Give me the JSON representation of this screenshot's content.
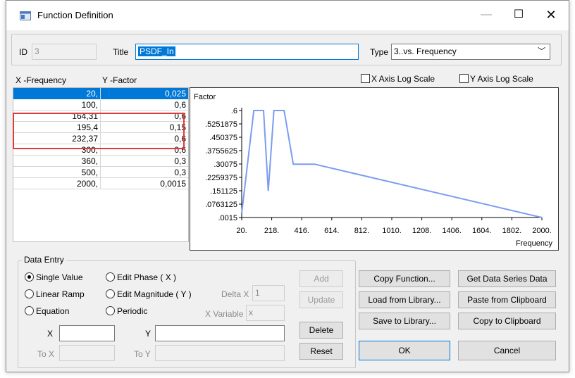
{
  "window": {
    "title": "Function Definition",
    "controls": {
      "minimize": "—",
      "maximize": "☐",
      "close": "✕"
    }
  },
  "header": {
    "id_label": "ID",
    "id_value": "3",
    "title_label": "Title",
    "title_value": "PSDF_In",
    "type_label": "Type",
    "type_value": "3..vs. Frequency"
  },
  "table": {
    "col_x": "X -Frequency",
    "col_y": "Y -Factor",
    "rows": [
      {
        "x": "20,",
        "y": "0,025"
      },
      {
        "x": "100,",
        "y": "0,6"
      },
      {
        "x": "164,31",
        "y": "0,6"
      },
      {
        "x": "195,4",
        "y": "0,15"
      },
      {
        "x": "232,37",
        "y": "0,6"
      },
      {
        "x": "300,",
        "y": "0,6"
      },
      {
        "x": "360,",
        "y": "0,3"
      },
      {
        "x": "500,",
        "y": "0,3"
      },
      {
        "x": "2000,",
        "y": "0,0015"
      }
    ]
  },
  "options": {
    "x_log": "X Axis Log Scale",
    "y_log": "Y Axis Log Scale"
  },
  "chart_data": {
    "type": "line",
    "ylabel": "Factor",
    "xlabel": "Frequency",
    "xlim": [
      20,
      2000
    ],
    "ylim": [
      0.0015,
      0.6
    ],
    "x_ticks": [
      "20.",
      "218.",
      "416.",
      "614.",
      "812.",
      "1010.",
      "1208.",
      "1406.",
      "1604.",
      "1802.",
      "2000."
    ],
    "y_ticks": [
      ".6",
      ".5251875",
      ".450375",
      ".3755625",
      ".30075",
      ".2259375",
      ".151125",
      ".0763125",
      ".0015"
    ],
    "x_tick_values": [
      20,
      218,
      416,
      614,
      812,
      1010,
      1208,
      1406,
      1604,
      1802,
      2000
    ],
    "y_tick_values": [
      0.6,
      0.5251875,
      0.450375,
      0.3755625,
      0.30075,
      0.2259375,
      0.151125,
      0.0763125,
      0.0015
    ],
    "series": [
      {
        "color": "#7b9cf0",
        "x": [
          20,
          100,
          164.31,
          195.4,
          232.37,
          300,
          360,
          500,
          2000
        ],
        "y": [
          0.025,
          0.6,
          0.6,
          0.15,
          0.6,
          0.6,
          0.3,
          0.3,
          0.0015
        ]
      }
    ]
  },
  "data_entry": {
    "group_title": "Data Entry",
    "radios": {
      "single_value": "Single Value",
      "linear_ramp": "Linear Ramp",
      "equation": "Equation",
      "edit_phase": "Edit Phase ( X )",
      "edit_magnitude": "Edit Magnitude ( Y )",
      "periodic": "Periodic"
    },
    "delta_x_label": "Delta X",
    "delta_x_value": "1",
    "x_variable_label": "X Variable",
    "x_variable_value": "x",
    "x_label": "X",
    "y_label": "Y",
    "to_x_label": "To X",
    "to_y_label": "To Y",
    "x_value": "",
    "y_value": "",
    "add": "Add",
    "update": "Update",
    "delete": "Delete",
    "reset": "Reset"
  },
  "actions": {
    "copy_function": "Copy Function...",
    "get_series": "Get Data Series Data",
    "load_library": "Load from Library...",
    "paste_clipboard": "Paste from Clipboard",
    "save_library": "Save to Library...",
    "copy_clipboard": "Copy to Clipboard",
    "ok": "OK",
    "cancel": "Cancel"
  }
}
